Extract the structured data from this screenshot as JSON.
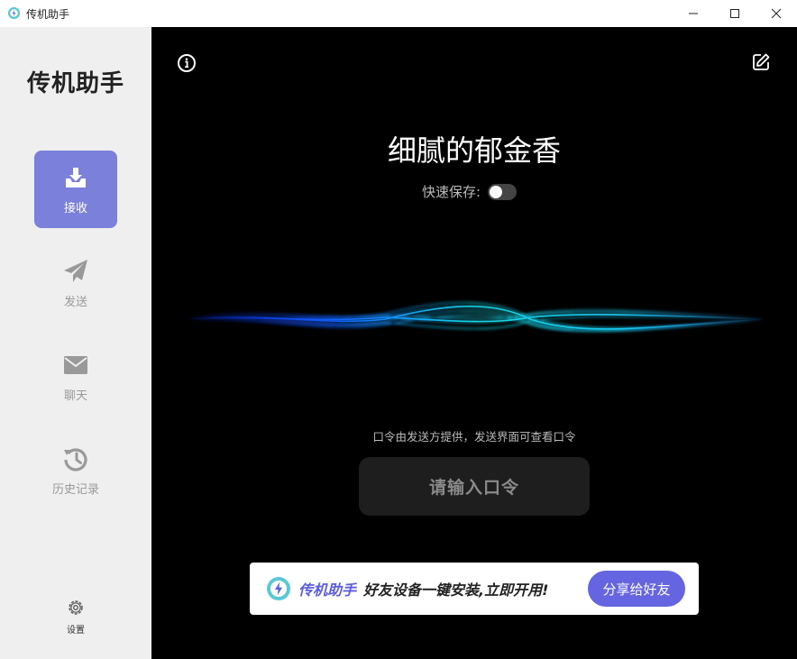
{
  "window": {
    "title": "传机助手",
    "controls": [
      "minimize-icon",
      "maximize-icon",
      "close-icon"
    ]
  },
  "sidebar": {
    "brand": "传机助手",
    "items": [
      {
        "label": "接收",
        "icon": "download-tray-icon",
        "active": true
      },
      {
        "label": "发送",
        "icon": "paper-plane-icon",
        "active": false
      },
      {
        "label": "聊天",
        "icon": "envelope-icon",
        "active": false
      },
      {
        "label": "历史记录",
        "icon": "history-icon",
        "active": false
      }
    ],
    "settings_label": "设置",
    "active_color": "#7b80da"
  },
  "main": {
    "device_name": "细腻的郁金香",
    "quick_save_label": "快速保存:",
    "quick_save_on": false,
    "hint": "口令由发送方提供，发送界面可查看口令",
    "code_placeholder": "请输入口令"
  },
  "banner": {
    "brand": "传机助手",
    "text": "好友设备一键安装,立即开用!",
    "share_label": "分享给好友",
    "accent": "#6565e2"
  }
}
